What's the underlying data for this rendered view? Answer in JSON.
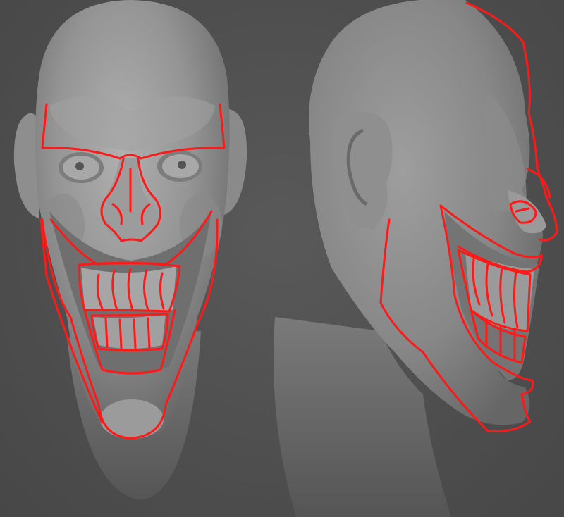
{
  "scene": {
    "background_color": "#4f4f4f",
    "mesh_color": "#9a9a9a",
    "overlay_color": "#ff1a1a"
  },
  "views": [
    {
      "id": "front",
      "description_icon": "head-front-view-icon"
    },
    {
      "id": "side",
      "description_icon": "head-side-view-icon"
    }
  ]
}
